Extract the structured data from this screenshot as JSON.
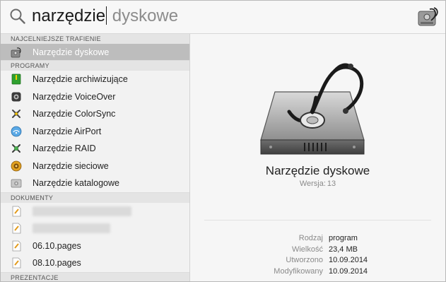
{
  "search": {
    "typed": "narzędzie",
    "completion": " dyskowe"
  },
  "sections": {
    "top_hit": "NAJCELNIEJSZE TRAFIENIE",
    "apps": "PROGRAMY",
    "docs": "DOKUMENTY",
    "presentations": "PREZENTACJE"
  },
  "top_hit": {
    "label": "Narzędzie dyskowe",
    "icon": "disk-utility-icon"
  },
  "apps": [
    {
      "label": "Narzędzie archiwizujące",
      "icon": "archive-utility-icon"
    },
    {
      "label": "Narzędzie VoiceOver",
      "icon": "voiceover-icon"
    },
    {
      "label": "Narzędzie ColorSync",
      "icon": "colorsync-icon"
    },
    {
      "label": "Narzędzie AirPort",
      "icon": "airport-icon"
    },
    {
      "label": "Narzędzie RAID",
      "icon": "raid-icon"
    },
    {
      "label": "Narzędzie sieciowe",
      "icon": "network-utility-icon"
    },
    {
      "label": "Narzędzie katalogowe",
      "icon": "directory-utility-icon"
    }
  ],
  "docs": [
    {
      "label": "",
      "icon": "pages-document-icon"
    },
    {
      "label": "",
      "icon": "pages-document-icon"
    },
    {
      "label": "06.10.pages",
      "icon": "pages-document-icon"
    },
    {
      "label": "08.10.pages",
      "icon": "pages-document-icon"
    }
  ],
  "preview": {
    "name": "Narzędzie dyskowe",
    "version_label": "Wersja:",
    "version": "13",
    "meta": [
      {
        "key": "Rodzaj",
        "value": "program"
      },
      {
        "key": "Wielkość",
        "value": "23,4 MB"
      },
      {
        "key": "Utworzono",
        "value": "10.09.2014"
      },
      {
        "key": "Modyfikowany",
        "value": "10.09.2014"
      }
    ]
  },
  "colors": {
    "selection": "#bdbdbd",
    "section_bg": "#e4e4e4",
    "completion_text": "#8c8c8c"
  }
}
